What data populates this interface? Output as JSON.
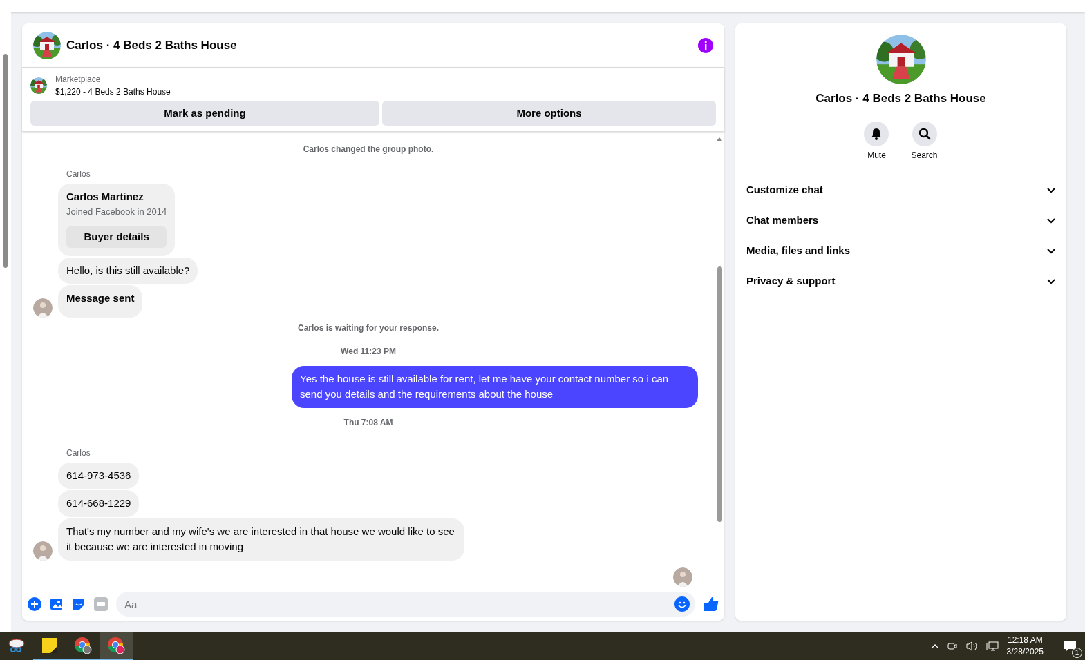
{
  "conversation": {
    "title": "Carlos · 4 Beds 2 Baths House"
  },
  "listing": {
    "source": "Marketplace",
    "summary": "$1,220 - 4 Beds 2 Baths House"
  },
  "actions": [
    "Mark as pending",
    "More options"
  ],
  "messages": [
    {
      "kind": "notice",
      "text": "Carlos changed the group photo."
    },
    {
      "kind": "sender",
      "text": "Carlos"
    },
    {
      "kind": "profile",
      "name": "Carlos Martinez",
      "detail": "Joined Facebook in 2014",
      "button": "Buyer details"
    },
    {
      "kind": "incoming",
      "text": "Hello, is this still available?",
      "avatar": false,
      "bold": false
    },
    {
      "kind": "incoming",
      "text": "Message sent",
      "avatar": true,
      "bold": true
    },
    {
      "kind": "notice",
      "text": "Carlos is waiting for your response."
    },
    {
      "kind": "time",
      "text": "Wed 11:23 PM"
    },
    {
      "kind": "outgoing",
      "text": "Yes the house is still available for rent, let me have your contact number so i can send you details and the requirements about the house"
    },
    {
      "kind": "time",
      "text": "Thu 7:08 AM"
    },
    {
      "kind": "sender",
      "text": "Carlos"
    },
    {
      "kind": "incoming",
      "text": "614-973-4536",
      "avatar": false,
      "bold": false
    },
    {
      "kind": "incoming",
      "text": "614-668-1229",
      "avatar": false,
      "bold": false
    },
    {
      "kind": "incoming",
      "text": "That's my number and my wife's we are interested in that house we would like to see it because we are interested in moving",
      "avatar": true,
      "bold": false
    }
  ],
  "composer": {
    "placeholder": "Aa"
  },
  "info_panel": {
    "title": "Carlos · 4 Beds 2 Baths House",
    "buttons": [
      {
        "kind": "mute",
        "label": "Mute"
      },
      {
        "kind": "search",
        "label": "Search"
      }
    ],
    "sections": [
      {
        "label": "Customize chat",
        "expanded": false
      },
      {
        "label": "Chat members",
        "expanded": false
      },
      {
        "label": "Media, files and links",
        "expanded": false
      },
      {
        "label": "Privacy & support",
        "expanded": false
      }
    ]
  },
  "taskbar": {
    "apps": [
      {
        "kind": "snip",
        "open": false,
        "selected": false
      },
      {
        "kind": "notes",
        "open": true,
        "selected": false
      },
      {
        "kind": "chrome",
        "open": true,
        "selected": false
      },
      {
        "kind": "chrome-profile",
        "open": true,
        "selected": true
      }
    ],
    "time": "12:18 AM",
    "date": "3/28/2025",
    "notifications": "1"
  }
}
